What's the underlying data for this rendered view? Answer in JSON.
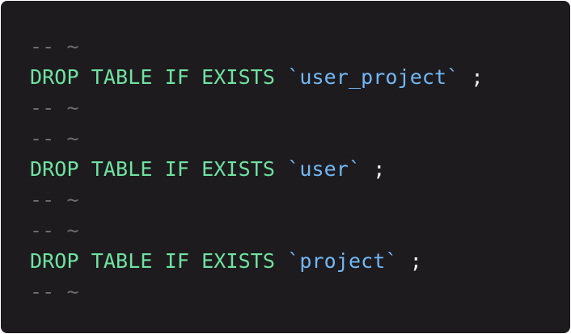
{
  "code": {
    "lines": [
      {
        "type": "comment",
        "text": "-- ~"
      },
      {
        "type": "statement",
        "keyword": "DROP TABLE IF EXISTS",
        "identifier": "`user_project`",
        "terminator": ";"
      },
      {
        "type": "comment",
        "text": "-- ~"
      },
      {
        "type": "comment",
        "text": "-- ~"
      },
      {
        "type": "statement",
        "keyword": "DROP TABLE IF EXISTS",
        "identifier": "`user`",
        "terminator": ";"
      },
      {
        "type": "comment",
        "text": "-- ~"
      },
      {
        "type": "comment",
        "text": "-- ~"
      },
      {
        "type": "statement",
        "keyword": "DROP TABLE IF EXISTS",
        "identifier": "`project`",
        "terminator": ";"
      },
      {
        "type": "comment",
        "text": "-- ~"
      }
    ]
  },
  "colors": {
    "background": "#1e1b1f",
    "comment": "#6c6c6c",
    "keyword": "#6fe3a0",
    "identifier": "#71b8f5",
    "punctuation": "#f2f2f2"
  }
}
